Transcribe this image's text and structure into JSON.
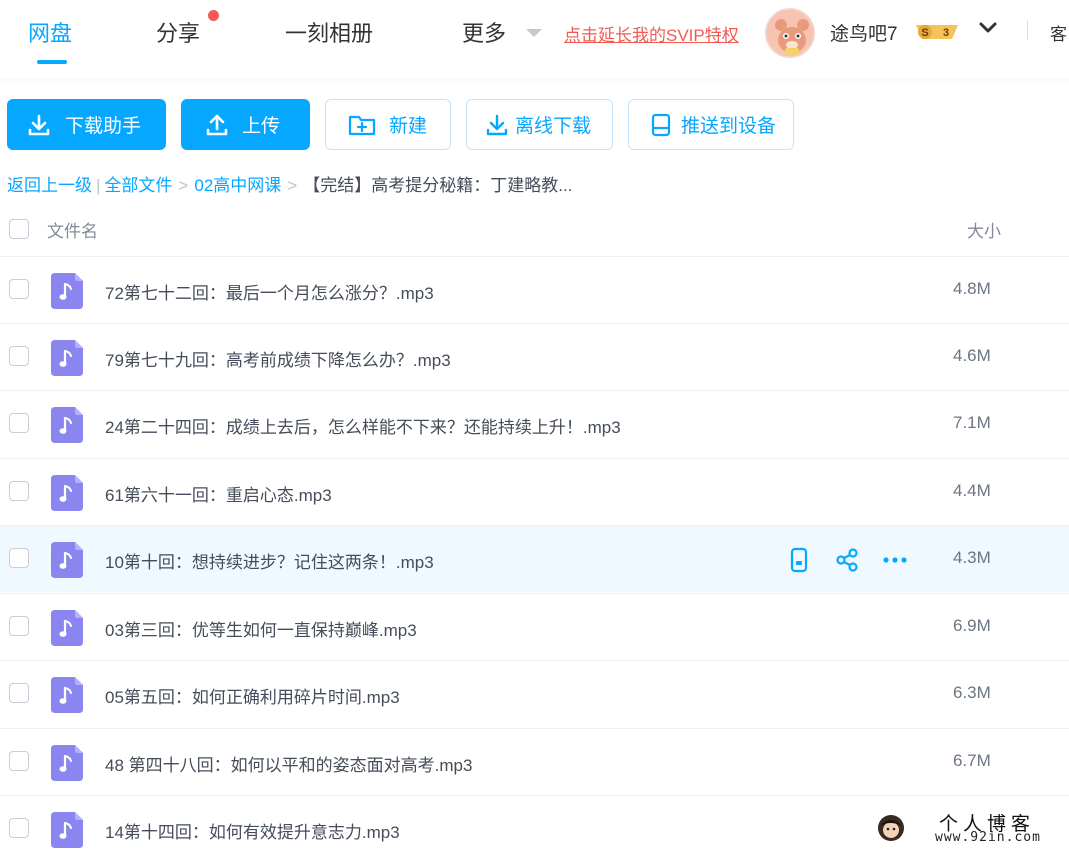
{
  "nav": {
    "tabs": [
      {
        "label": "网盘",
        "active": true
      },
      {
        "label": "分享",
        "has_notification_dot": true
      },
      {
        "label": "一刻相册"
      },
      {
        "label": "更多"
      }
    ],
    "promo_link": "点击延长我的SVIP特权",
    "user": {
      "name": "途鸟吧7",
      "badge_letter": "S",
      "badge_level": "3"
    },
    "service_label": "客"
  },
  "toolbar": {
    "download_helper": "下载助手",
    "upload": "上传",
    "new_folder": "新建",
    "offline_download": "离线下载",
    "push_to_device": "推送到设备"
  },
  "breadcrumb": {
    "back": "返回上一级",
    "all_files": "全部文件",
    "folder": "02高中网课",
    "current": "【完结】高考提分秘籍：丁建略教..."
  },
  "table": {
    "col_name": "文件名",
    "col_size": "大小",
    "rows": [
      {
        "name": "72第七十二回：最后一个月怎么涨分？.mp3",
        "size": "4.8M"
      },
      {
        "name": "79第七十九回：高考前成绩下降怎么办？.mp3",
        "size": "4.6M"
      },
      {
        "name": "24第二十四回：成绩上去后，怎么样能不下来？还能持续上升！.mp3",
        "size": "7.1M"
      },
      {
        "name": "61第六十一回：重启心态.mp3",
        "size": "4.4M"
      },
      {
        "name": "10第十回：想持续进步？记住这两条！.mp3",
        "size": "4.3M"
      },
      {
        "name": "03第三回：优等生如何一直保持巅峰.mp3",
        "size": "6.9M"
      },
      {
        "name": "05第五回：如何正确利用碎片时间.mp3",
        "size": "6.3M"
      },
      {
        "name": "48 第四十八回：如何以平和的姿态面对高考.mp3",
        "size": "6.7M"
      },
      {
        "name": "14第十四回：如何有效提升意志力.mp3",
        "size": ""
      }
    ]
  },
  "watermark": {
    "title": "个人博客",
    "url": "www.92in.com"
  },
  "colors": {
    "accent": "#06a7ff",
    "promo": "#f25a52",
    "audio_icon": "#8b85f0",
    "hover_row": "#f0f9ff"
  }
}
